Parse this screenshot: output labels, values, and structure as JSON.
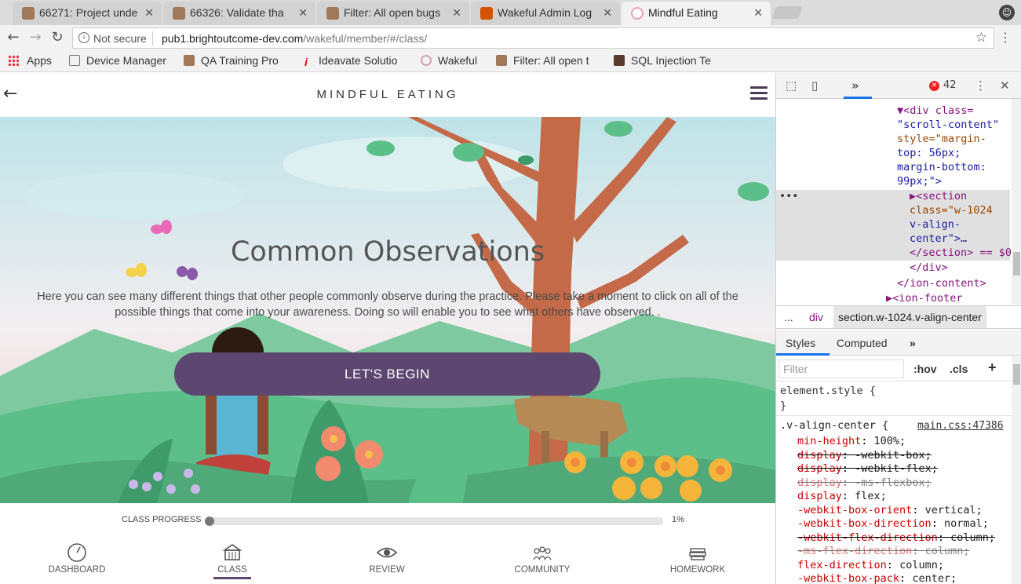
{
  "browser": {
    "tabs": [
      {
        "title": "66271: Project unde",
        "favicon_color": "#a0785a"
      },
      {
        "title": "66326: Validate tha",
        "favicon_color": "#a0785a"
      },
      {
        "title": "Filter: All open bugs",
        "favicon_color": "#a0785a"
      },
      {
        "title": "Wakeful Admin Log",
        "favicon_color": "#d35400"
      },
      {
        "title": "Mindful Eating",
        "favicon_color": "#e8c4d4"
      }
    ],
    "active_tab_index": 4,
    "close_glyph": "✕",
    "security_text": "Not secure",
    "url_host": "pub1.brightoutcome-dev.com",
    "url_path": "/wakeful/member/#/class/",
    "bookmarks": [
      {
        "label": "Apps",
        "icon": "apps-grid-icon"
      },
      {
        "label": "Device Manager",
        "icon": "page-icon"
      },
      {
        "label": "QA Training Pro",
        "icon": "bug-icon"
      },
      {
        "label": "Ideavate Solutio",
        "icon": "i-icon"
      },
      {
        "label": "Wakeful",
        "icon": "wakeful-icon"
      },
      {
        "label": "Filter: All open t",
        "icon": "bug-icon"
      },
      {
        "label": "SQL Injection Te",
        "icon": "cube-icon"
      }
    ]
  },
  "app": {
    "header_title": "MINDFUL EATING",
    "section_title": "Common Observations",
    "description": "Here you can see many different things that other people commonly observe during the practice. Please take a moment to click on all of the possible things that come into your awareness. Doing so will enable you to see what others have observed.  .",
    "begin_label": "LET'S BEGIN",
    "progress_label": "CLASS PROGRESS",
    "progress_percent_text": "1%",
    "progress_value": 0.01,
    "accent_color": "#5d4670",
    "nav": [
      {
        "label": "DASHBOARD",
        "icon": "dashboard-gauge-icon"
      },
      {
        "label": "CLASS",
        "icon": "class-building-icon"
      },
      {
        "label": "REVIEW",
        "icon": "review-eye-icon"
      },
      {
        "label": "COMMUNITY",
        "icon": "community-people-icon"
      },
      {
        "label": "HOMEWORK",
        "icon": "homework-books-icon"
      }
    ],
    "active_nav_index": 1
  },
  "devtools": {
    "error_count": "42",
    "dom_lines": [
      {
        "t": "▼<div class="
      },
      {
        "t": "\"scroll-content\""
      },
      {
        "t": "style=\"margin-"
      },
      {
        "t": "top: 56px;"
      },
      {
        "t": "margin-bottom:"
      },
      {
        "t": "99px;\">"
      },
      {
        "t": "▶<section"
      },
      {
        "t": "class=\"w-1024"
      },
      {
        "t": "v-align-"
      },
      {
        "t": "center\">…"
      },
      {
        "t": "</section> == $0"
      },
      {
        "t": "</div>"
      },
      {
        "t": "</ion-content>"
      },
      {
        "t": "▶<ion-footer"
      }
    ],
    "breadcrumb_ellipsis": "...",
    "breadcrumb_div": "div",
    "breadcrumb_selected": "section.w-1024.v-align-center",
    "style_tabs": [
      "Styles",
      "Computed",
      "»"
    ],
    "filter_placeholder": "Filter",
    "hov": ":hov",
    "cls": ".cls",
    "plus": "+",
    "element_style_open": "element.style {",
    "element_style_close": "}",
    "rule_selector": ".v-align-center {",
    "rule_source": "main.css:47386",
    "declarations": [
      {
        "p": "min-height",
        "v": "100%;"
      },
      {
        "p": "display",
        "v": "-webkit-box;"
      },
      {
        "p": "display",
        "v": "-webkit-flex;"
      },
      {
        "p": "display",
        "v": "-ms-flexbox;"
      },
      {
        "p": "display",
        "v": "flex;"
      },
      {
        "p": "-webkit-box-orient",
        "v": "vertical;"
      },
      {
        "p": "-webkit-box-direction",
        "v": "normal;"
      },
      {
        "p": "-webkit-flex-direction",
        "v": "column;"
      },
      {
        "p": "-ms-flex-direction",
        "v": "column;"
      },
      {
        "p": "flex-direction",
        "v": "column;"
      },
      {
        "p": "-webkit-box-pack",
        "v": "center;"
      }
    ]
  }
}
